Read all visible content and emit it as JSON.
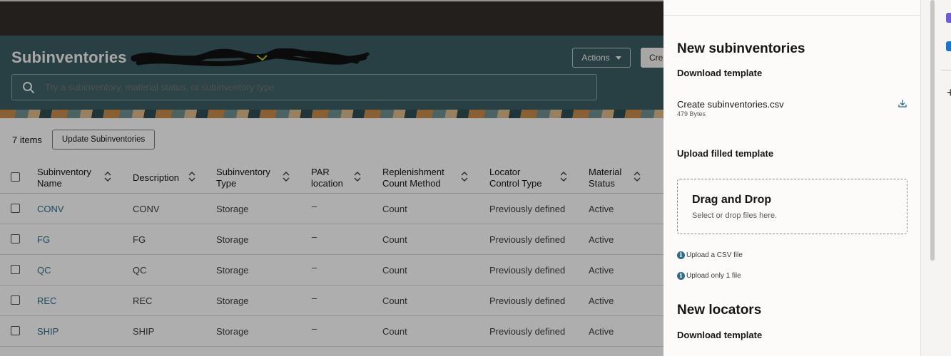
{
  "header": {
    "title": "Subinventories",
    "actions_label": "Actions",
    "create_label": "Create"
  },
  "search": {
    "placeholder": "Try a subinventory, material status, or subinventory type"
  },
  "toolbar": {
    "items_count": "7 items",
    "update_label": "Update Subinventories"
  },
  "table": {
    "columns": [
      {
        "line1": "Subinventory",
        "line2": "Name"
      },
      {
        "line1": "Description",
        "line2": ""
      },
      {
        "line1": "Subinventory",
        "line2": "Type"
      },
      {
        "line1": "PAR",
        "line2": "location"
      },
      {
        "line1": "Replenishment",
        "line2": "Count Method"
      },
      {
        "line1": "Locator",
        "line2": "Control Type"
      },
      {
        "line1": "Material",
        "line2": "Status"
      }
    ],
    "rows": [
      {
        "name": "CONV",
        "description": "CONV",
        "type": "Storage",
        "par": "–",
        "method": "Count",
        "locator": "Previously defined",
        "status": "Active"
      },
      {
        "name": "FG",
        "description": "FG",
        "type": "Storage",
        "par": "–",
        "method": "Count",
        "locator": "Previously defined",
        "status": "Active"
      },
      {
        "name": "QC",
        "description": "QC",
        "type": "Storage",
        "par": "–",
        "method": "Count",
        "locator": "Previously defined",
        "status": "Active"
      },
      {
        "name": "REC",
        "description": "REC",
        "type": "Storage",
        "par": "–",
        "method": "Count",
        "locator": "Previously defined",
        "status": "Active"
      },
      {
        "name": "SHIP",
        "description": "SHIP",
        "type": "Storage",
        "par": "–",
        "method": "Count",
        "locator": "Previously defined",
        "status": "Active"
      }
    ]
  },
  "drawer": {
    "section1_title": "New subinventories",
    "download_heading": "Download template",
    "file_name": "Create subinventories.csv",
    "file_size": "479 Bytes",
    "upload_heading": "Upload filled template",
    "dropzone_title": "Drag and Drop",
    "dropzone_sub": "Select or drop files here.",
    "hint1": "Upload a CSV file",
    "hint2": "Upload only 1 file",
    "section2_title": "New locators",
    "download_heading2": "Download template"
  },
  "icons": {
    "search": "search-icon",
    "download": "download-icon",
    "info": "info-icon",
    "sort": "sort-icon",
    "plus": "plus-icon"
  },
  "colors": {
    "hero_bg": "#3a5c62",
    "topbar_bg": "#312d2a",
    "link": "#2c6b8a"
  }
}
